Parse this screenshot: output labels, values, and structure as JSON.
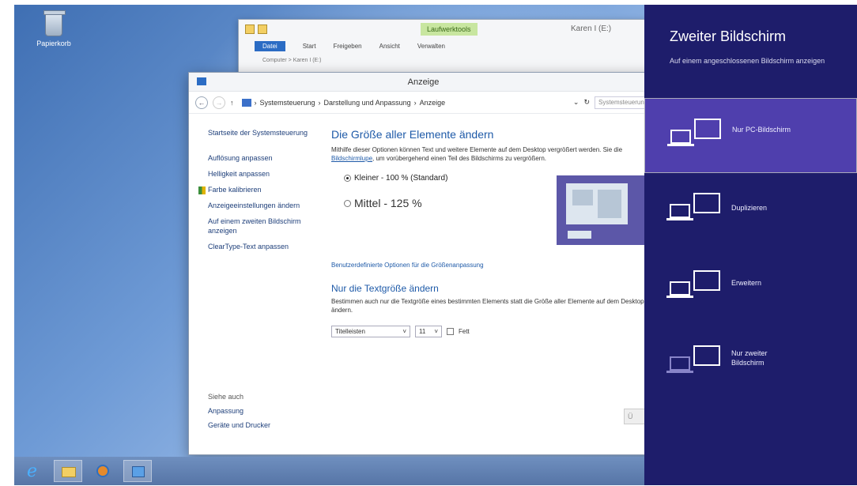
{
  "desktop": {
    "recycle_bin_label": "Papierkorb"
  },
  "explorer": {
    "title": "Karen I (E:)",
    "context_tab": "Laufwerktools",
    "ribbon_tabs": [
      "Datei",
      "Start",
      "Freigeben",
      "Ansicht",
      "Verwalten"
    ],
    "address": "Computer > Karen I (E:)"
  },
  "control_panel": {
    "title": "Anzeige",
    "breadcrumb": [
      "Systemsteuerung",
      "Darstellung und Anpassung",
      "Anzeige"
    ],
    "search_placeholder": "Systemsteuerung durchsuchen",
    "sidebar": {
      "home": "Startseite der Systemsteuerung",
      "items": [
        "Auflösung anpassen",
        "Helligkeit anpassen",
        "Farbe kalibrieren",
        "Anzeigeeinstellungen ändern",
        "Auf einem zweiten Bildschirm anzeigen",
        "ClearType-Text anpassen"
      ]
    },
    "see_also": {
      "heading": "Siehe auch",
      "links": [
        "Anpassung",
        "Geräte und Drucker"
      ]
    },
    "main": {
      "heading": "Die Größe aller Elemente ändern",
      "desc_before": "Mithilfe dieser Optionen können Text und weitere Elemente auf dem Desktop vergrößert werden. Sie die",
      "desc_link": "Bildschirmlupe",
      "desc_after": ", um vorübergehend einen Teil des Bildschirms zu vergrößern.",
      "option_small": "Kleiner - 100 % (Standard)",
      "option_medium": "Mittel - 125 %",
      "custom_link": "Benutzerdefinierte Optionen für die Größenanpassung",
      "text_heading": "Nur die Textgröße ändern",
      "text_desc": "Bestimmen auch nur die Textgröße eines bestimmten Elements statt die Größe aller Elemente auf dem Desktop ändern.",
      "element_select": "Titelleisten",
      "size_select": "11",
      "bold_label": "Fett",
      "apply_label": "Ü"
    }
  },
  "charm": {
    "title": "Zweiter Bildschirm",
    "subtitle": "Auf einem angeschlossenen Bildschirm anzeigen",
    "options": [
      {
        "label": "Nur PC-Bildschirm",
        "selected": true
      },
      {
        "label": "Duplizieren",
        "selected": false
      },
      {
        "label": "Erweitern",
        "selected": false
      },
      {
        "label": "Nur zweiter Bildschirm",
        "selected": false
      }
    ]
  },
  "taskbar": {
    "buttons": [
      "internet-explorer-icon",
      "file-explorer-icon",
      "media-player-icon",
      "control-panel-icon"
    ]
  },
  "colors": {
    "charm_bg": "#1e1d6b",
    "charm_selected": "#4f3fad",
    "link_blue": "#1e5aa8"
  }
}
